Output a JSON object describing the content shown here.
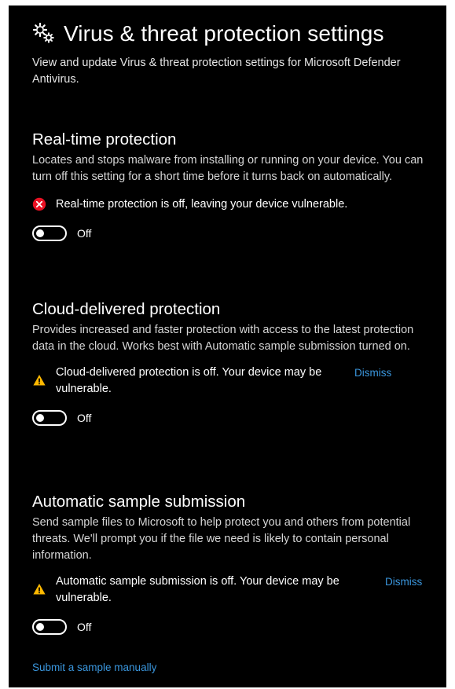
{
  "header": {
    "icon": "gear-icon",
    "title": "Virus & threat protection settings",
    "description": "View and update Virus & threat protection settings for Microsoft Defender Antivirus."
  },
  "sections": [
    {
      "title": "Real-time protection",
      "description": "Locates and stops malware from installing or running on your device. You can turn off this setting for a short time before it turns back on automatically.",
      "alert": {
        "icon": "error-icon",
        "text": "Real-time protection is off, leaving your device vulnerable."
      },
      "toggle": {
        "state": "Off"
      }
    },
    {
      "title": "Cloud-delivered protection",
      "description": "Provides increased and faster protection with access to the latest protection data in the cloud. Works best with Automatic sample submission turned on.",
      "alert": {
        "icon": "warning-icon",
        "text": "Cloud-delivered protection is off. Your device may be vulnerable.",
        "dismiss": "Dismiss"
      },
      "toggle": {
        "state": "Off"
      }
    },
    {
      "title": "Automatic sample submission",
      "description": "Send sample files to Microsoft to help protect you and others from potential threats. We'll prompt you if the file we need is likely to contain personal information.",
      "alert": {
        "icon": "warning-icon",
        "text": "Automatic sample submission is off. Your device may be vulnerable.",
        "dismiss": "Dismiss"
      },
      "toggle": {
        "state": "Off"
      }
    }
  ],
  "footer": {
    "submit_link": "Submit a sample manually"
  },
  "colors": {
    "background": "#000000",
    "text": "#ffffff",
    "link": "#3a96dd",
    "error": "#e81123",
    "warning": "#ffb900"
  }
}
